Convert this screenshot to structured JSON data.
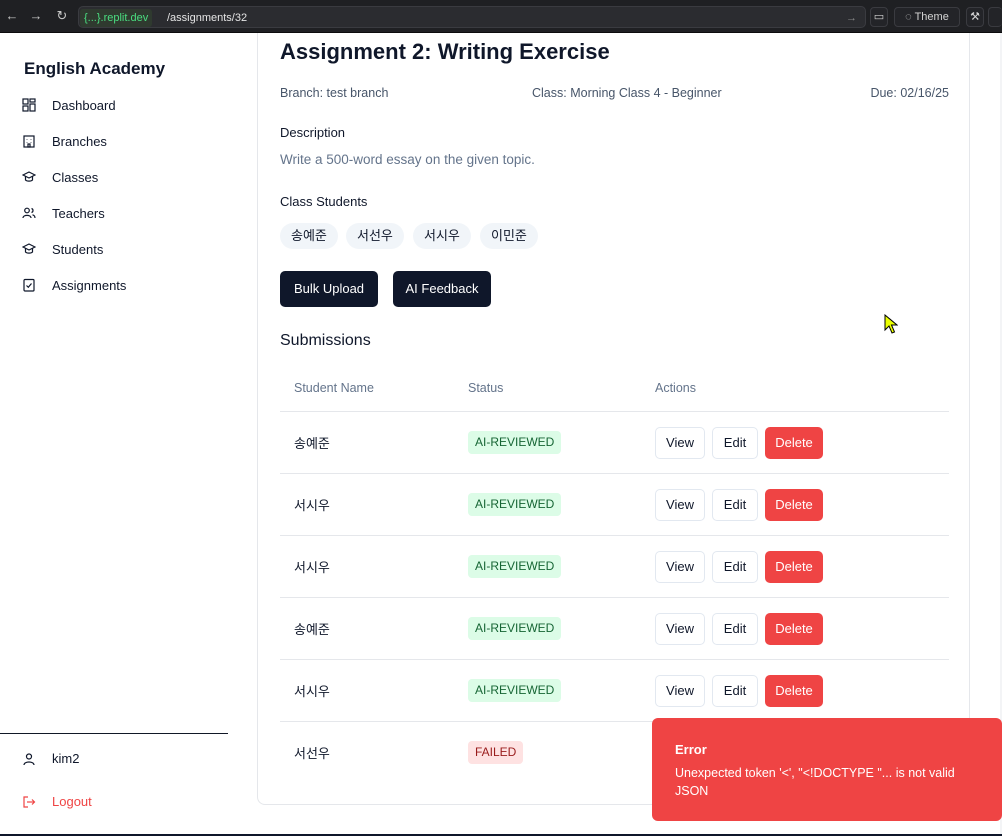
{
  "browser": {
    "domain": "{...}.replit.dev",
    "path": "/assignments/32",
    "theme_label": "Theme"
  },
  "sidebar": {
    "brand": "English Academy",
    "items": [
      {
        "label": "Dashboard",
        "icon": "dashboard-icon"
      },
      {
        "label": "Branches",
        "icon": "building-icon"
      },
      {
        "label": "Classes",
        "icon": "graduation-cap-icon"
      },
      {
        "label": "Teachers",
        "icon": "users-icon"
      },
      {
        "label": "Students",
        "icon": "graduation-cap-icon"
      },
      {
        "label": "Assignments",
        "icon": "clipboard-check-icon"
      }
    ],
    "user": "kim2",
    "logout": "Logout"
  },
  "assignment": {
    "title": "Assignment 2: Writing Exercise",
    "branch": "Branch: test branch",
    "class": "Class: Morning Class 4 - Beginner",
    "due": "Due: 02/16/25",
    "description_label": "Description",
    "description": "Write a 500-word essay on the given topic.",
    "students_label": "Class Students",
    "students": [
      "송예준",
      "서선우",
      "서시우",
      "이민준"
    ]
  },
  "actions": {
    "bulk_upload": "Bulk Upload",
    "ai_feedback": "AI Feedback"
  },
  "submissions": {
    "title": "Submissions",
    "columns": [
      "Student Name",
      "Status",
      "Actions"
    ],
    "rows": [
      {
        "name": "송예준",
        "status": "AI-REVIEWED"
      },
      {
        "name": "서시우",
        "status": "AI-REVIEWED"
      },
      {
        "name": "서시우",
        "status": "AI-REVIEWED"
      },
      {
        "name": "송예준",
        "status": "AI-REVIEWED"
      },
      {
        "name": "서시우",
        "status": "AI-REVIEWED"
      },
      {
        "name": "서선우",
        "status": "FAILED"
      }
    ],
    "view_label": "View",
    "edit_label": "Edit",
    "delete_label": "Delete"
  },
  "toast": {
    "title": "Error",
    "message": "Unexpected token '<', \"<!DOCTYPE \"... is not valid JSON"
  },
  "colors": {
    "primary": "#0f172a",
    "danger": "#ef4444",
    "success_bg": "#dcfce7",
    "success_text": "#166534",
    "fail_bg": "#fee2e2",
    "fail_text": "#991b1b"
  }
}
